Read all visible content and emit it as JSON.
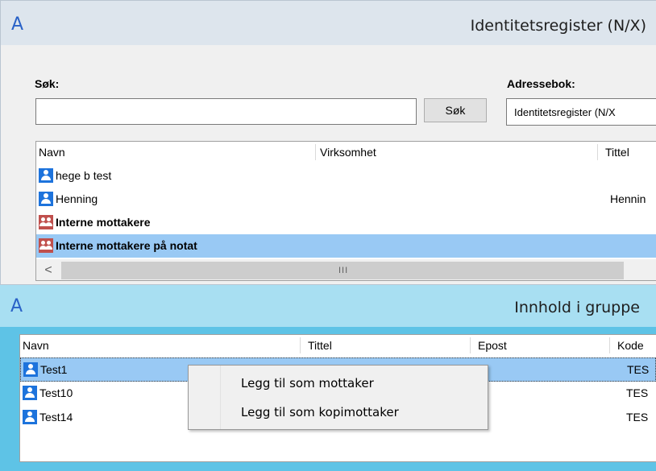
{
  "window1": {
    "title": "Identitetsregister (N/X)",
    "logo_icon": "app-logo-a-icon",
    "search_label": "Søk:",
    "search_value": "",
    "search_button": "Søk",
    "address_book_label": "Adressebok:",
    "address_book_value": "Identitetsregister (N/X",
    "columns": [
      "Navn",
      "Virksomhet",
      "Tittel"
    ],
    "rows": [
      {
        "type": "person",
        "name": "hege b test",
        "company": "",
        "title": "",
        "bold": false,
        "selected": false
      },
      {
        "type": "person",
        "name": "Henning",
        "company": "",
        "title": "Hennin",
        "bold": false,
        "selected": false
      },
      {
        "type": "group",
        "name": "Interne mottakere",
        "company": "",
        "title": "",
        "bold": true,
        "selected": false
      },
      {
        "type": "group",
        "name": "Interne mottakere på notat",
        "company": "",
        "title": "",
        "bold": true,
        "selected": true
      }
    ],
    "scroll_left": "<",
    "scroll_grip": "III"
  },
  "window2": {
    "title": "Innhold i gruppe",
    "logo_icon": "app-logo-a-icon",
    "columns": [
      "Navn",
      "Tittel",
      "Epost",
      "Kode"
    ],
    "rows": [
      {
        "name": "Test1",
        "title": "",
        "email": "",
        "code": "TES",
        "selected": true
      },
      {
        "name": "Test10",
        "title": "",
        "email": "",
        "code": "TES",
        "selected": false
      },
      {
        "name": "Test14",
        "title": "",
        "email": "",
        "code": "TES",
        "selected": false
      }
    ]
  },
  "context_menu": {
    "items": [
      "Legg til som mottaker",
      "Legg til som kopimottaker"
    ]
  },
  "colors": {
    "window1_titlebar": "#dde5ed",
    "window2_background": "#5ec3e6",
    "selection": "#99c9f4",
    "person_icon": "#1d73dc",
    "group_icon": "#c0504d"
  }
}
